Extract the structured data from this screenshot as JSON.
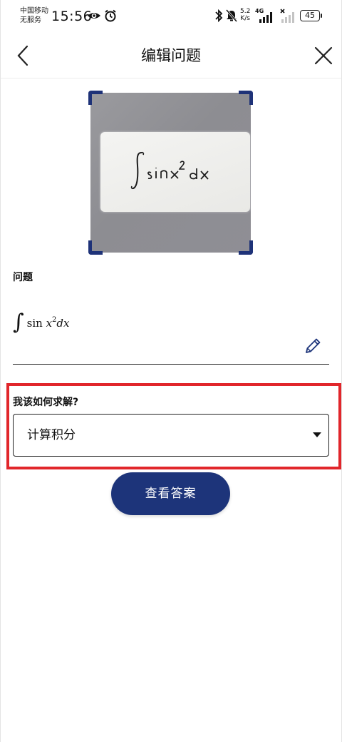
{
  "status_bar": {
    "carrier_line1": "中国移动",
    "carrier_line2": "无服务",
    "time": "15:56",
    "net_speed_value": "5.2",
    "net_speed_unit": "K/s",
    "network_type": "4G",
    "battery": "45",
    "icons": [
      "eye-icon",
      "alarm-icon",
      "bluetooth-icon",
      "mute-icon",
      "signal-icon",
      "no-signal-icon"
    ]
  },
  "header": {
    "title": "编辑问题",
    "back_icon": "chevron-left-icon",
    "close_icon": "close-icon"
  },
  "problem": {
    "label": "问题",
    "formula_prefix": "sin ",
    "formula_var": "x",
    "formula_exp": "2",
    "formula_suffix": "dx",
    "integral_sign": "∫",
    "edit_icon": "pencil-icon"
  },
  "solve": {
    "label": "我该如何求解?",
    "selected_option": "计算积分"
  },
  "actions": {
    "view_answer": "查看答案"
  },
  "colors": {
    "primary": "#1d347a",
    "highlight": "#e1262b",
    "crop_corner": "#1e3278"
  }
}
